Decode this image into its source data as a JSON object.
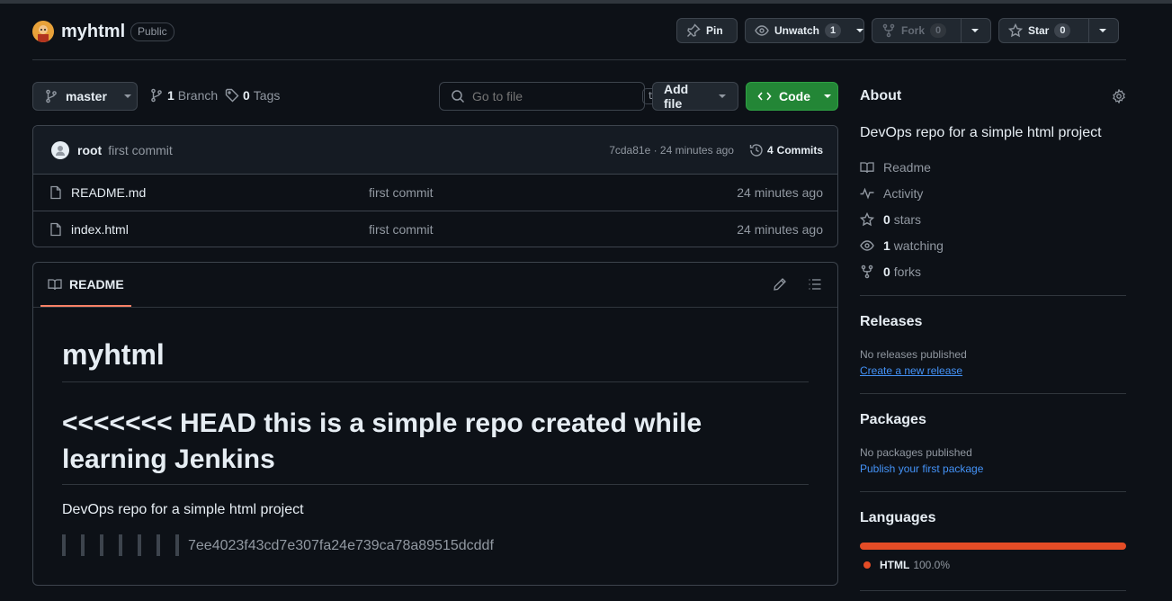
{
  "repo": {
    "name": "myhtml",
    "visibility": "Public"
  },
  "actions": {
    "pin": "Pin",
    "unwatch": "Unwatch",
    "unwatch_count": "1",
    "fork": "Fork",
    "fork_count": "0",
    "star": "Star",
    "star_count": "0"
  },
  "toolbar": {
    "branch": "master",
    "branches_count": "1",
    "branches_label": "Branch",
    "tags_count": "0",
    "tags_label": "Tags",
    "search_placeholder": "Go to file",
    "search_shortcut": "t",
    "add_file": "Add file",
    "code": "Code"
  },
  "commit": {
    "author": "root",
    "message": "first commit",
    "hash_time": "7cda81e · 24 minutes ago",
    "commits_count": "4",
    "commits_label": "Commits"
  },
  "files": [
    {
      "name": "README.md",
      "message": "first commit",
      "time": "24 minutes ago"
    },
    {
      "name": "index.html",
      "message": "first commit",
      "time": "24 minutes ago"
    }
  ],
  "readme": {
    "tab": "README",
    "h1": "myhtml",
    "h2": "<<<<<<< HEAD this is a simple repo created while learning Jenkins",
    "paragraph": "DevOps repo for a simple html project",
    "bars": "| | | | | | |",
    "hash": "7ee4023f43cd7e307fa24e739ca78a89515dcddf"
  },
  "about": {
    "title": "About",
    "description": "DevOps repo for a simple html project",
    "readme": "Readme",
    "activity": "Activity",
    "stars_count": "0",
    "stars_label": "stars",
    "watching_count": "1",
    "watching_label": "watching",
    "forks_count": "0",
    "forks_label": "forks"
  },
  "releases": {
    "title": "Releases",
    "empty": "No releases published",
    "link": "Create a new release"
  },
  "packages": {
    "title": "Packages",
    "empty": "No packages published",
    "link": "Publish your first package"
  },
  "languages": {
    "title": "Languages",
    "items": [
      {
        "name": "HTML",
        "percent": "100.0%",
        "share": 100,
        "color": "#e34c26"
      }
    ]
  },
  "colors": {
    "accent_green": "#238636",
    "link_blue": "#4493f8",
    "html_lang": "#e34c26",
    "readme_underline": "#f78166"
  }
}
